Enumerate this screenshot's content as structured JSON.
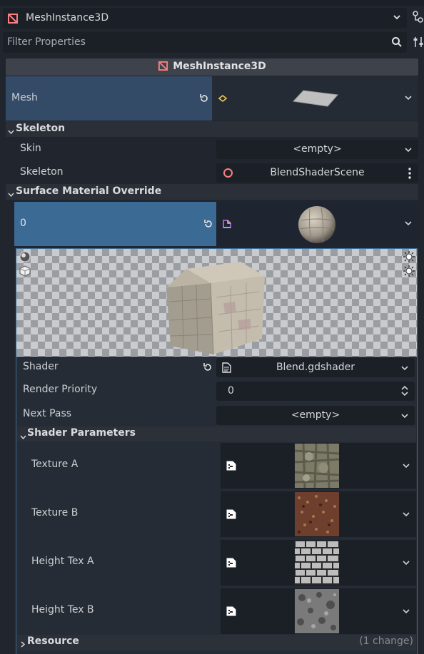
{
  "header": {
    "node_selector": "MeshInstance3D",
    "filter_placeholder": "Filter Properties",
    "class_title": "MeshInstance3D"
  },
  "mesh": {
    "label": "Mesh"
  },
  "skeleton_section": {
    "title": "Skeleton",
    "skin_label": "Skin",
    "skin_value": "<empty>",
    "skeleton_label": "Skeleton",
    "skeleton_value": "BlendShaderScene"
  },
  "material_section": {
    "title": "Surface Material Override",
    "slot_label": "0",
    "shader_label": "Shader",
    "shader_value": "Blend.gdshader",
    "render_priority_label": "Render Priority",
    "render_priority_value": "0",
    "next_pass_label": "Next Pass",
    "next_pass_value": "<empty>"
  },
  "shader_params": {
    "title": "Shader Parameters",
    "items": [
      {
        "label": "Texture A"
      },
      {
        "label": "Texture B"
      },
      {
        "label": "Height Tex A"
      },
      {
        "label": "Height Tex B"
      }
    ]
  },
  "resource_section": {
    "title": "Resource",
    "changes": "(1 change)"
  },
  "colors": {
    "accent": "#3a6e99",
    "selected_row": "#334b66",
    "slot_row": "#3b6a94",
    "node_icon": "#fc7f7f"
  }
}
